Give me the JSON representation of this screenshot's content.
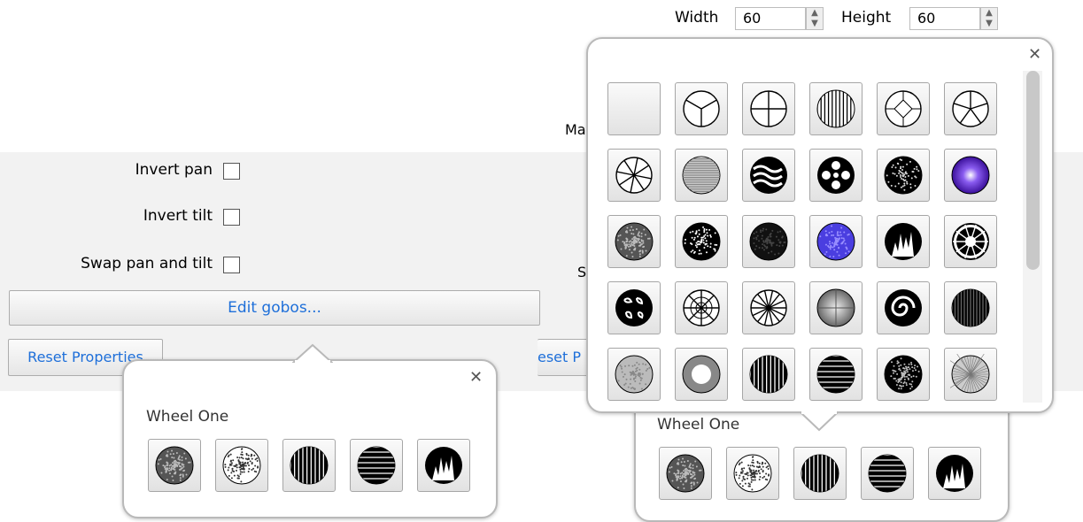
{
  "left": {
    "invert_pan": "Invert pan",
    "invert_tilt": "Invert tilt",
    "swap_pan_tilt": "Swap pan and tilt",
    "edit_gobos": "Edit gobos...",
    "reset_properties": "Reset Properties",
    "popup": {
      "close": "✕",
      "wheel_label": "Wheel One"
    }
  },
  "right": {
    "width_label": "Width",
    "width_value": "60",
    "height_label": "Height",
    "height_value": "60",
    "partial_ma": "Ma",
    "partial_s": "S",
    "partial_reset": "eset P",
    "popup_close": "✕",
    "wheel_label": "Wheel One"
  },
  "gobo_grid": [
    "blank",
    "three-spoke",
    "cross",
    "half-lines",
    "diamond",
    "five-spoke",
    "eight-spoke",
    "horizontal-lines",
    "waves",
    "flower",
    "noise-dark",
    "purple-radial",
    "gray-noise",
    "dots",
    "dark-noise",
    "blue-noise",
    "flames",
    "gear",
    "swirl",
    "web",
    "star-burst",
    "radial-gray",
    "spiral",
    "vertical-streaks",
    "light-gray",
    "ring",
    "flame-streaks",
    "stripes",
    "speckle",
    "radial-fine"
  ],
  "wheel_one": [
    "gray-noise",
    "light-noise",
    "flame-streaks",
    "stripes",
    "flames"
  ]
}
